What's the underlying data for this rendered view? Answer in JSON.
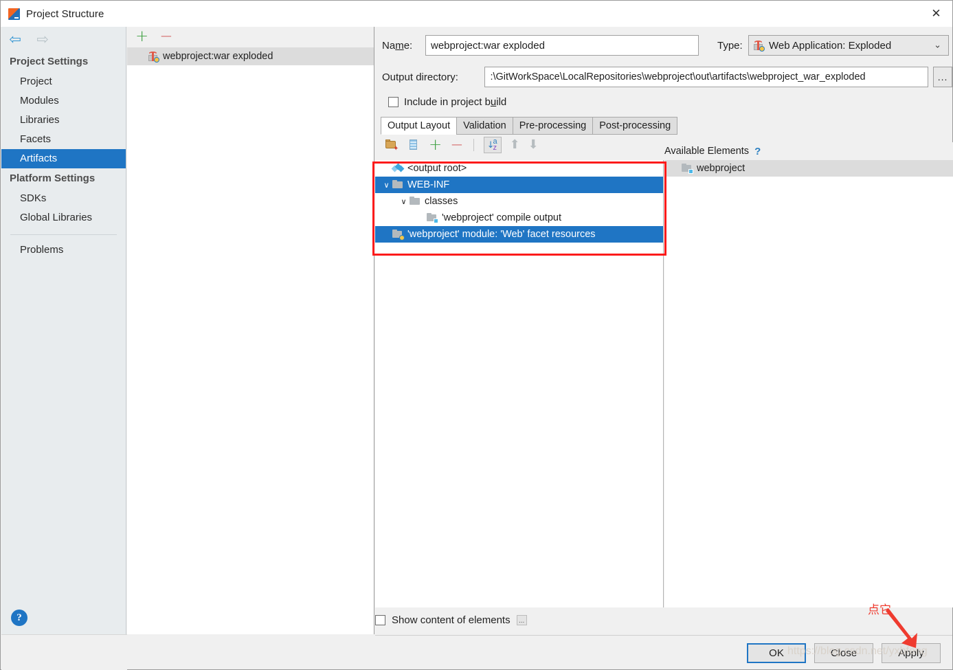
{
  "window": {
    "title": "Project Structure",
    "app_icon": "intellij-idea-icon",
    "close_label": "✕"
  },
  "sidebar": {
    "nav": {
      "back": "⇦",
      "forward": "⇨"
    },
    "groups": [
      {
        "label": "Project Settings",
        "items": [
          {
            "label": "Project",
            "selected": false
          },
          {
            "label": "Modules",
            "selected": false
          },
          {
            "label": "Libraries",
            "selected": false
          },
          {
            "label": "Facets",
            "selected": false
          },
          {
            "label": "Artifacts",
            "selected": true
          }
        ]
      },
      {
        "label": "Platform Settings",
        "items": [
          {
            "label": "SDKs",
            "selected": false
          },
          {
            "label": "Global Libraries",
            "selected": false
          }
        ]
      }
    ],
    "problems": {
      "label": "Problems"
    },
    "help_badge": "?"
  },
  "artifact_list": {
    "toolbar": {
      "add": "+",
      "remove": "−"
    },
    "items": [
      {
        "label": "webproject:war exploded",
        "icon": "artifact-gift-icon",
        "selected": true
      }
    ]
  },
  "detail": {
    "name_label": "Name:",
    "name_value": "webproject:war exploded",
    "type_label": "Type:",
    "type_value": "Web Application: Exploded",
    "type_icon": "artifact-gift-icon",
    "type_caret": "⌄",
    "output_dir_label": "Output directory:",
    "output_dir_value": ":\\GitWorkSpace\\LocalRepositories\\webproject\\out\\artifacts\\webproject_war_exploded",
    "browse_label": "...",
    "include_in_build_label": "Include in project build",
    "include_in_build_checked": false,
    "tabs": [
      {
        "label": "Output Layout",
        "active": true
      },
      {
        "label": "Validation",
        "active": false
      },
      {
        "label": "Pre-processing",
        "active": false
      },
      {
        "label": "Post-processing",
        "active": false
      }
    ],
    "tree_toolbar": [
      {
        "name": "create-directory-icon"
      },
      {
        "name": "create-archive-icon"
      },
      {
        "name": "add-icon",
        "glyph": "+"
      },
      {
        "name": "remove-icon",
        "glyph": "−"
      },
      {
        "name": "sort-az-icon"
      },
      {
        "name": "move-up-icon",
        "glyph": "⬆"
      },
      {
        "name": "move-down-icon",
        "glyph": "⬇"
      }
    ],
    "output_tree": [
      {
        "label": "<output root>",
        "icon": "output-root-icon",
        "indent": 0,
        "chevron": "",
        "state": "none"
      },
      {
        "label": "WEB-INF",
        "icon": "folder-icon",
        "indent": 0,
        "chevron": "∨",
        "state": "selected"
      },
      {
        "label": "classes",
        "icon": "folder-icon",
        "indent": 1,
        "chevron": "∨",
        "state": "none"
      },
      {
        "label": "'webproject' compile output",
        "icon": "module-output-icon",
        "indent": 2,
        "chevron": "",
        "state": "none"
      },
      {
        "label": "'webproject' module: 'Web' facet resources",
        "icon": "facet-resources-icon",
        "indent": 0,
        "chevron": "",
        "state": "selected"
      }
    ],
    "available_header": "Available Elements",
    "available_help": "?",
    "available_tree": [
      {
        "label": "webproject",
        "icon": "module-output-icon",
        "indent": 0,
        "state": "grey"
      }
    ],
    "show_content_label": "Show content of elements",
    "show_content_checked": false,
    "show_content_more": "..."
  },
  "buttons": [
    {
      "label": "OK",
      "default": true
    },
    {
      "label": "Close",
      "default": false
    },
    {
      "label": "Apply",
      "default": false
    }
  ],
  "annotations": {
    "click_it_text": "点它",
    "watermark": "https://blog.csdn.net/yxbfeng"
  },
  "colors": {
    "accent": "#1f75c4",
    "annotation_red": "#fc1b1b",
    "sidebar_bg": "#e8ecee"
  }
}
